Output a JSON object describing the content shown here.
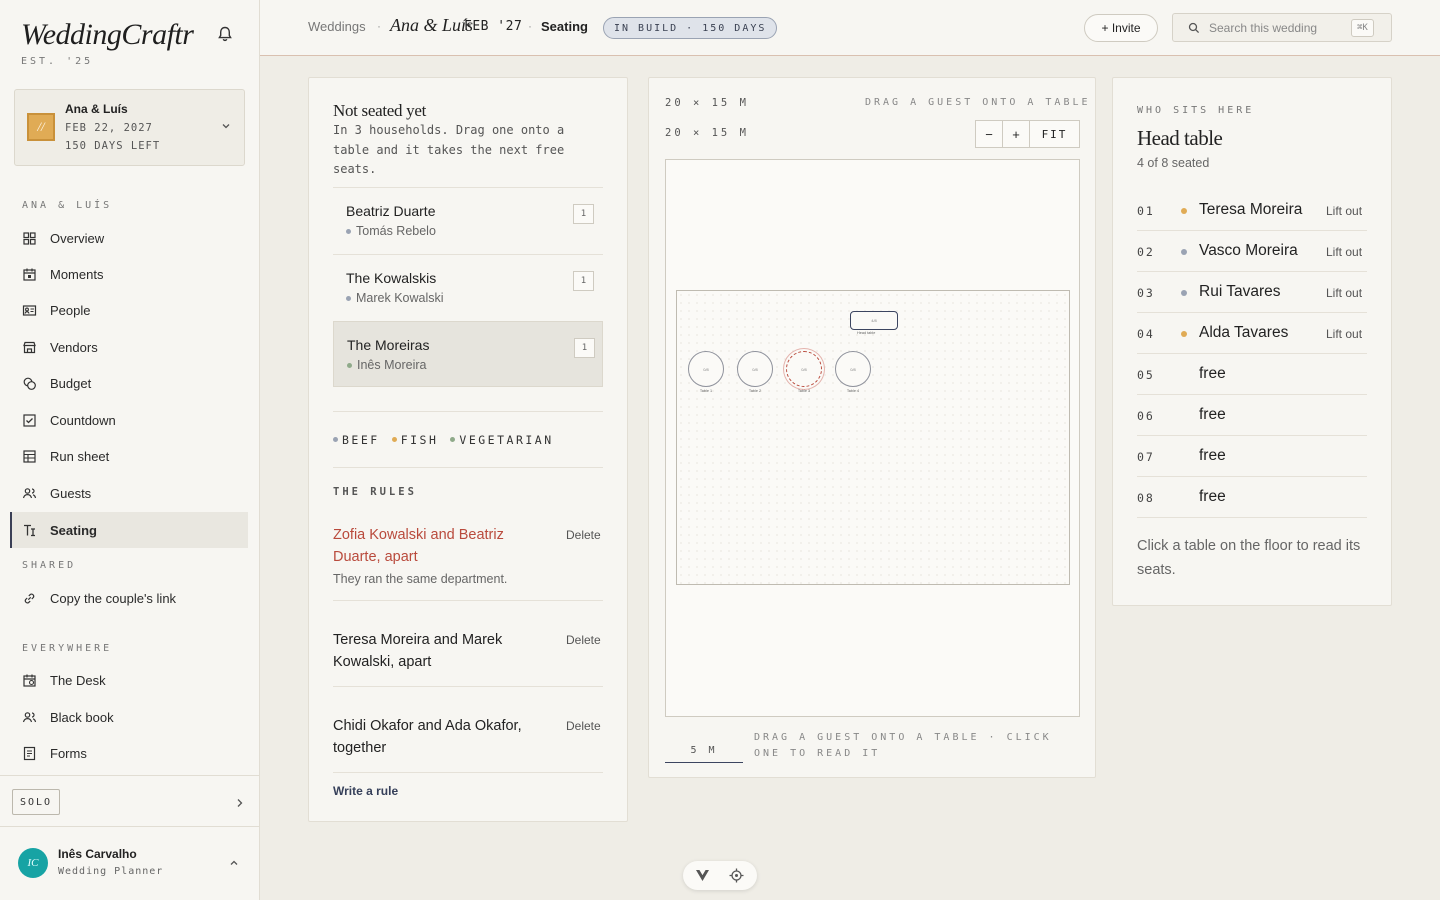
{
  "app": {
    "brand": "WeddingCraftr",
    "brand_sub": "EST. '25"
  },
  "wedding": {
    "initials": "//",
    "name": "Ana & Luís",
    "date": "FEB 22, 2027",
    "days_left": "150 DAYS LEFT"
  },
  "sidebar": {
    "section_couple": "ANA & LUÍS",
    "items": [
      {
        "label": "Overview",
        "icon": "grid-icon"
      },
      {
        "label": "Moments",
        "icon": "calendar-icon"
      },
      {
        "label": "People",
        "icon": "id-card-icon"
      },
      {
        "label": "Vendors",
        "icon": "storefront-icon"
      },
      {
        "label": "Budget",
        "icon": "coins-icon"
      },
      {
        "label": "Countdown",
        "icon": "checkbox-icon"
      },
      {
        "label": "Run sheet",
        "icon": "table-icon"
      },
      {
        "label": "Guests",
        "icon": "users-icon"
      },
      {
        "label": "Seating",
        "icon": "seating-icon",
        "active": true
      }
    ],
    "section_shared": "SHARED",
    "shared_items": [
      {
        "label": "Copy the couple's link",
        "icon": "link-icon"
      }
    ],
    "section_everywhere": "EVERYWHERE",
    "everywhere_items": [
      {
        "label": "The Desk",
        "icon": "desk-icon"
      },
      {
        "label": "Black book",
        "icon": "contacts-icon"
      },
      {
        "label": "Forms",
        "icon": "form-icon"
      }
    ],
    "mode": "SOLO",
    "user": {
      "initials": "IC",
      "name": "Inês Carvalho",
      "role": "Wedding Planner"
    }
  },
  "topbar": {
    "crumb_weddings": "Weddings",
    "crumb_couple": "Ana & Luís",
    "crumb_date": "FEB '27",
    "crumb_page": "Seating",
    "status": "IN BUILD · 150 DAYS",
    "invite_label": "+ Invite",
    "search_placeholder": "Search this wedding",
    "search_shortcut": "⌘K"
  },
  "not_seated": {
    "title": "Not seated yet",
    "description": "In 3 households. Drag one onto a table and it takes the next free seats.",
    "households": [
      {
        "name": "Beatriz Duarte",
        "member": "Tomás Rebelo",
        "count": "1"
      },
      {
        "name": "The Kowalskis",
        "member": "Marek Kowalski",
        "count": "1"
      },
      {
        "name": "The Moreiras",
        "member": "Inês Moreira",
        "count": "1",
        "selected": true
      }
    ],
    "legend": [
      {
        "label": "BEEF",
        "color": "#9aa3b3"
      },
      {
        "label": "FISH",
        "color": "#e0ab55"
      },
      {
        "label": "VEGETARIAN",
        "color": "#8faa8a"
      }
    ],
    "rules_label": "THE RULES",
    "rules": [
      {
        "text": "Zofia Kowalski and Beatriz Duarte, apart",
        "note": "They ran the same department.",
        "action": "Delete",
        "warn": true
      },
      {
        "text": "Teresa Moreira and Marek Kowalski, apart",
        "note": "",
        "action": "Delete",
        "warn": false
      },
      {
        "text": "Chidi Okafor and Ada Okafor, together",
        "note": "",
        "action": "Delete",
        "warn": false
      }
    ],
    "write_rule": "Write a rule"
  },
  "floor": {
    "dim1": "20 × 15 M",
    "dim2": "20 × 15 M",
    "hint": "DRAG A GUEST ONTO A TABLE",
    "zoom_out": "−",
    "zoom_in": "+",
    "fit": "FIT",
    "head_table": {
      "seats": "4/8",
      "label": "Head table"
    },
    "tables": [
      {
        "label": "Table 1",
        "seats": "0/8"
      },
      {
        "label": "Table 2",
        "seats": "0/8"
      },
      {
        "label": "Table 3",
        "seats": "0/8",
        "highlight": true
      },
      {
        "label": "Table 4",
        "seats": "0/8"
      }
    ],
    "scale": "5 M",
    "footer": "DRAG A GUEST ONTO A TABLE · CLICK ONE TO READ IT"
  },
  "who_sits": {
    "label": "WHO SITS HERE",
    "title": "Head table",
    "count": "4 of 8 seated",
    "seats": [
      {
        "no": "01",
        "name": "Teresa Moreira",
        "dot": "#e0ab55",
        "action": "Lift out"
      },
      {
        "no": "02",
        "name": "Vasco Moreira",
        "dot": "#9aa3b3",
        "action": "Lift out"
      },
      {
        "no": "03",
        "name": "Rui Tavares",
        "dot": "#9aa3b3",
        "action": "Lift out"
      },
      {
        "no": "04",
        "name": "Alda Tavares",
        "dot": "#e0ab55",
        "action": "Lift out"
      },
      {
        "no": "05",
        "name": "free",
        "dot": "",
        "action": ""
      },
      {
        "no": "06",
        "name": "free",
        "dot": "",
        "action": ""
      },
      {
        "no": "07",
        "name": "free",
        "dot": "",
        "action": ""
      },
      {
        "no": "08",
        "name": "free",
        "dot": "",
        "action": ""
      }
    ],
    "footer": "Click a table on the floor to read its seats."
  }
}
